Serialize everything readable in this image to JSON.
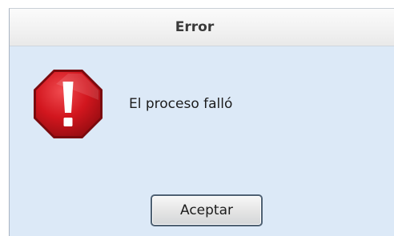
{
  "dialog": {
    "title": "Error",
    "message": "El proceso falló",
    "icon": "error-stop-icon",
    "ok_label": "Aceptar"
  },
  "colors": {
    "background": "#dce9f7",
    "icon_red": "#c8141c",
    "button_border": "#4f6173"
  }
}
